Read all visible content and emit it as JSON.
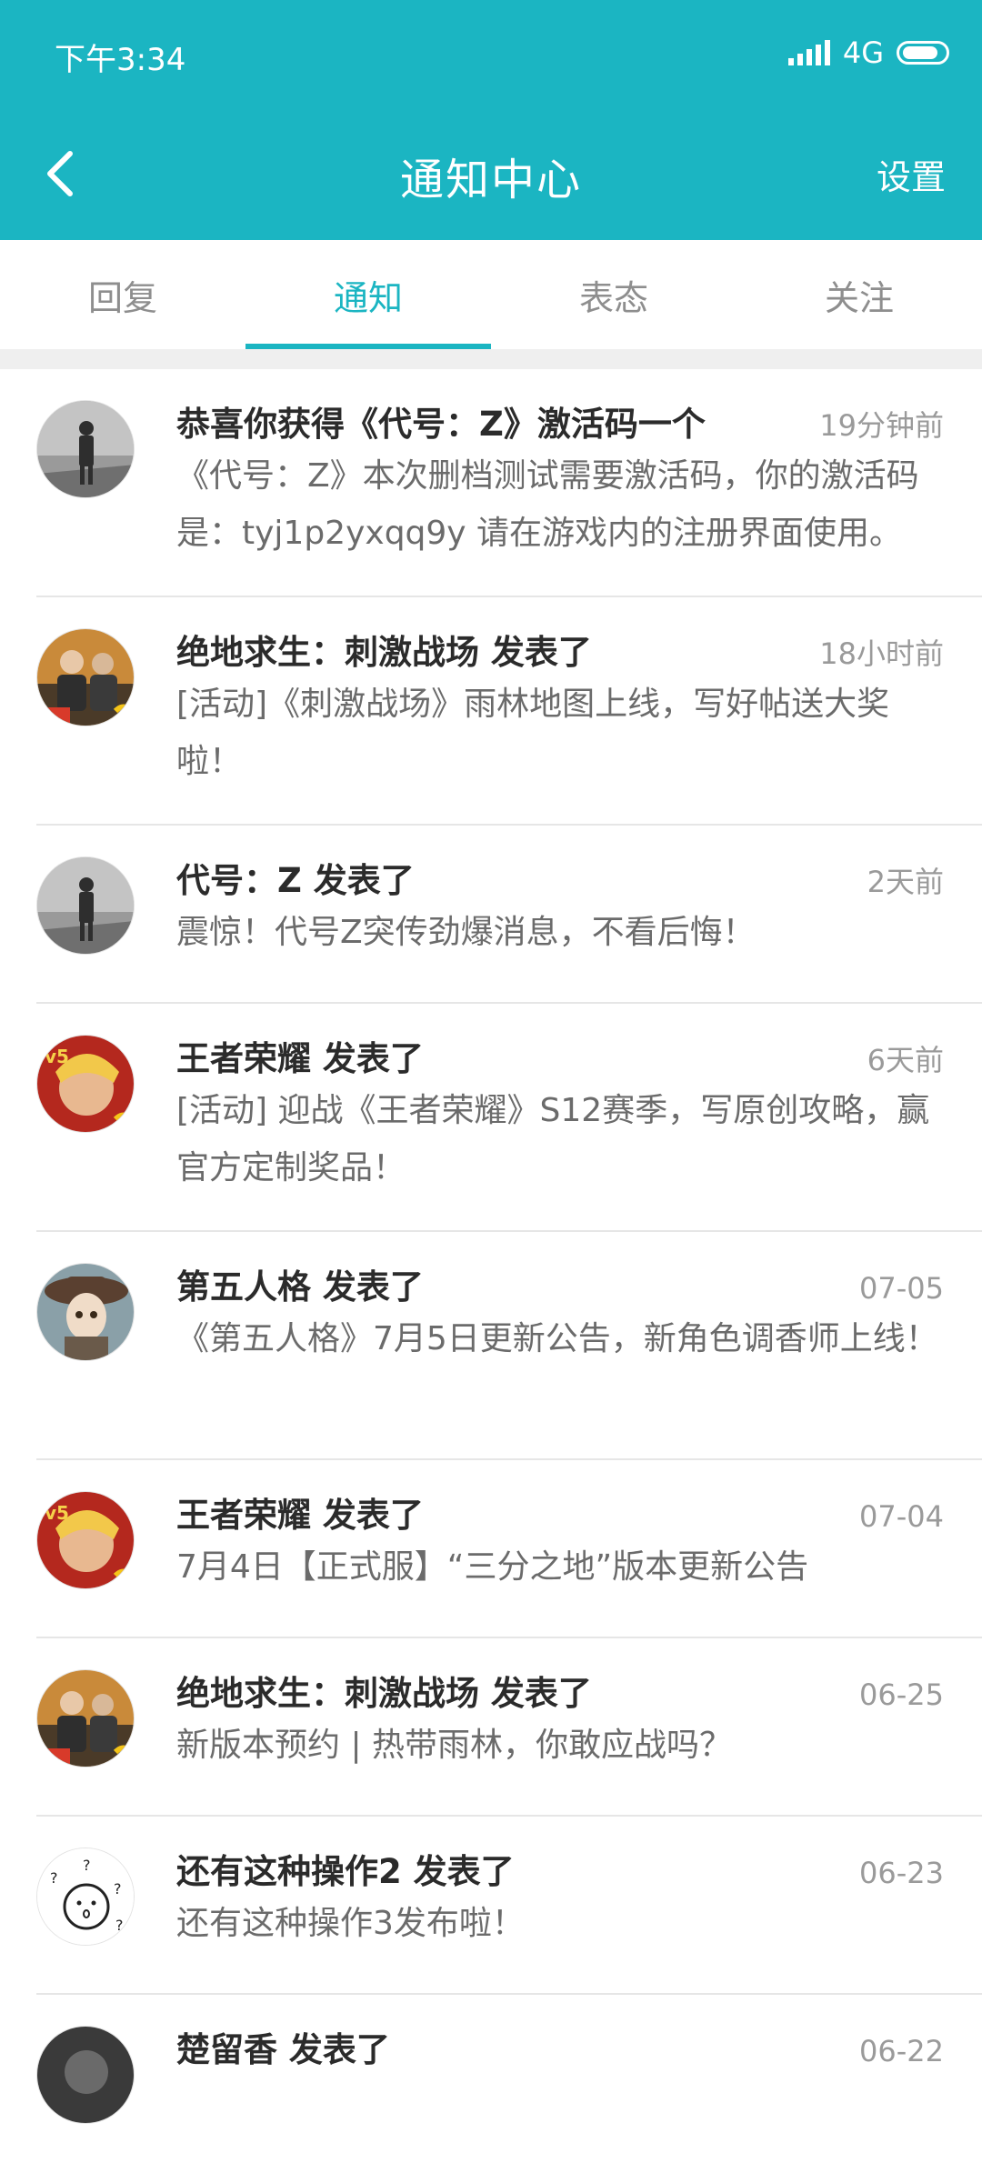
{
  "status_bar": {
    "time": "下午3:34",
    "network": "4G",
    "colors": {
      "bar_background": "#1bb5c2"
    }
  },
  "header": {
    "title": "通知中心",
    "settings_label": "设置",
    "back_icon": "chevron-left-icon",
    "accent_color": "#1bb5c2"
  },
  "tabs": [
    {
      "label": "回复",
      "active": false
    },
    {
      "label": "通知",
      "active": true
    },
    {
      "label": "表态",
      "active": false
    },
    {
      "label": "关注",
      "active": false
    }
  ],
  "notifications": [
    {
      "avatar": "soldier-gray-avatar",
      "title": "恭喜你获得《代号：Z》激活码一个",
      "time": "19分钟前",
      "body": "《代号：Z》本次删档测试需要激活码，你的激活码是：tyj1p2yxqq9y 请在游戏内的注册界面使用。"
    },
    {
      "avatar": "pubg-rainforest-avatar",
      "title": "绝地求生：刺激战场 发表了",
      "time": "18小时前",
      "body": "[活动]《刺激战场》雨林地图上线，写好帖送大奖啦！"
    },
    {
      "avatar": "soldier-gray-avatar",
      "title": "代号：Z 发表了",
      "time": "2天前",
      "body": "震惊！代号Z突传劲爆消息，不看后悔！"
    },
    {
      "avatar": "honor-of-kings-avatar",
      "title": "王者荣耀 发表了",
      "time": "6天前",
      "body": "[活动] 迎战《王者荣耀》S12赛季，写原创攻略，赢官方定制奖品！"
    },
    {
      "avatar": "identity-v-avatar",
      "title": "第五人格 发表了",
      "time": "07-05",
      "body": "《第五人格》7月5日更新公告，新角色调香师上线！"
    },
    {
      "avatar": "honor-of-kings-avatar",
      "title": "王者荣耀 发表了",
      "time": "07-04",
      "body": "7月4日【正式服】“三分之地”版本更新公告"
    },
    {
      "avatar": "pubg-rainforest-avatar",
      "title": "绝地求生：刺激战场 发表了",
      "time": "06-25",
      "body": "新版本预约 | 热带雨林，你敢应战吗？"
    },
    {
      "avatar": "question-face-avatar",
      "title": "还有这种操作2 发表了",
      "time": "06-23",
      "body": "还有这种操作3发布啦！"
    },
    {
      "avatar": "dark-character-avatar",
      "title": "楚留香 发表了",
      "time": "06-22",
      "body": ""
    }
  ]
}
